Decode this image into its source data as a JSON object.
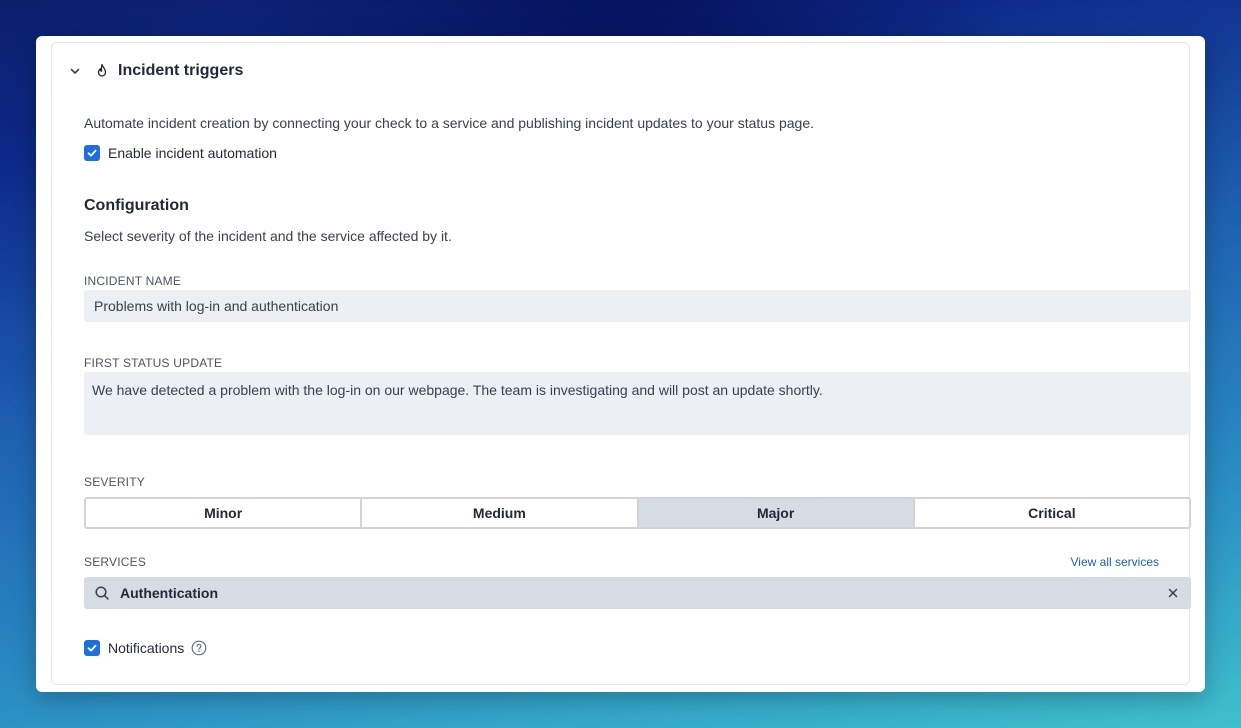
{
  "panel": {
    "title": "Incident triggers",
    "icons": {
      "collapse": "chevron-down-icon",
      "section": "flame-icon"
    },
    "description": "Automate incident creation by connecting your check to a service and publishing incident updates to your status page.",
    "enable_label": "Enable incident automation",
    "enable_checked": true
  },
  "configuration": {
    "title": "Configuration",
    "description": "Select severity of the incident and the service affected by it.",
    "incident_name": {
      "label": "INCIDENT NAME",
      "value": "Problems with log-in and authentication"
    },
    "first_status_update": {
      "label": "FIRST STATUS UPDATE",
      "value": "We have detected a problem with the log-in on our webpage. The team is investigating and will post an update shortly."
    },
    "severity": {
      "label": "SEVERITY",
      "options": [
        "Minor",
        "Medium",
        "Major",
        "Critical"
      ],
      "selected": "Major"
    },
    "services": {
      "label": "SERVICES",
      "view_all": "View all services",
      "value": "Authentication"
    },
    "notifications": {
      "label": "Notifications",
      "checked": true
    }
  },
  "colors": {
    "accent": "#1d6fe0",
    "link": "#1d5fb8",
    "input_bg": "#eceff3",
    "selected_bg": "#d6dce4"
  }
}
